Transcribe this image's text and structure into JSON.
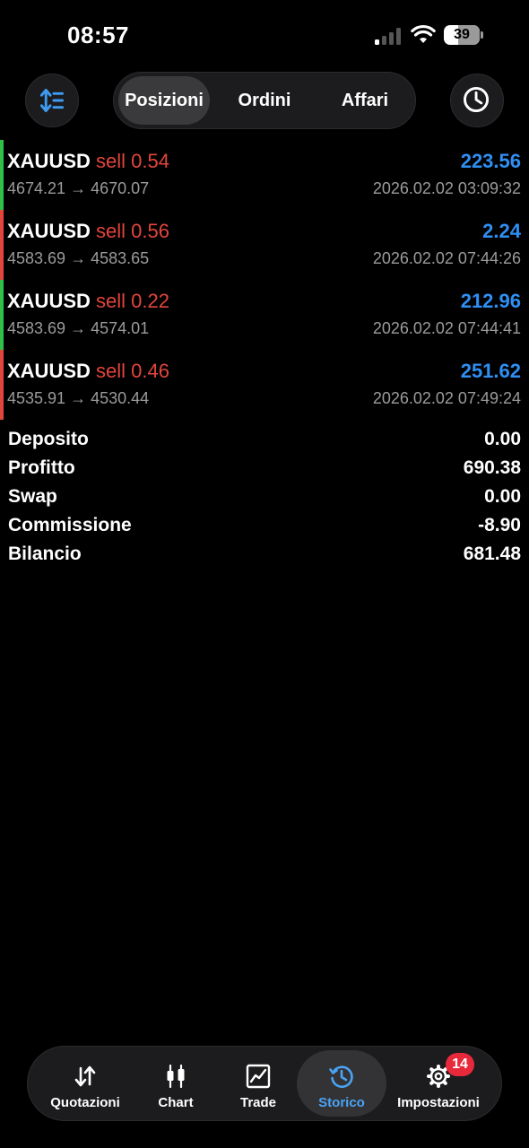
{
  "status_bar": {
    "time": "08:57",
    "battery": "39"
  },
  "toolbar": {
    "tabs": [
      {
        "label": "Posizioni",
        "active": true
      },
      {
        "label": "Ordini",
        "active": false
      },
      {
        "label": "Affari",
        "active": false
      }
    ],
    "left_icon": "sort-icon",
    "right_icon": "clock-icon"
  },
  "trades": [
    {
      "symbol": "XAUUSD",
      "direction": "sell 0.54",
      "profit": "223.56",
      "open_price": "4674.21",
      "arrow": "→",
      "close_price": "4670.07",
      "datetime": "2026.02.02 03:09:32",
      "bar_color": "#2ec14a"
    },
    {
      "symbol": "XAUUSD",
      "direction": "sell 0.56",
      "profit": "2.24",
      "open_price": "4583.69",
      "arrow": "→",
      "close_price": "4583.65",
      "datetime": "2026.02.02 07:44:26",
      "bar_color": "#e2453c"
    },
    {
      "symbol": "XAUUSD",
      "direction": "sell 0.22",
      "profit": "212.96",
      "open_price": "4583.69",
      "arrow": "→",
      "close_price": "4574.01",
      "datetime": "2026.02.02 07:44:41",
      "bar_color": "#2ec14a"
    },
    {
      "symbol": "XAUUSD",
      "direction": "sell 0.46",
      "profit": "251.62",
      "open_price": "4535.91",
      "arrow": "→",
      "close_price": "4530.44",
      "datetime": "2026.02.02 07:49:24",
      "bar_color": "#e2453c"
    }
  ],
  "summary": [
    {
      "label": "Deposito",
      "value": "0.00"
    },
    {
      "label": "Profitto",
      "value": "690.38"
    },
    {
      "label": "Swap",
      "value": "0.00"
    },
    {
      "label": "Commissione",
      "value": "-8.90"
    },
    {
      "label": "Bilancio",
      "value": "681.48"
    }
  ],
  "tabbar": {
    "items": [
      {
        "label": "Quotazioni",
        "icon": "quotes-icon"
      },
      {
        "label": "Chart",
        "icon": "candlestick-icon"
      },
      {
        "label": "Trade",
        "icon": "trade-chart-icon"
      },
      {
        "label": "Storico",
        "icon": "history-icon",
        "active": true
      },
      {
        "label": "Impostazioni",
        "icon": "gear-icon"
      }
    ],
    "settings_badge": "14"
  },
  "colors": {
    "accent": "#2f8ff3",
    "sell": "#e2453c",
    "buy_bar": "#2ec14a",
    "badge": "#e8293b"
  }
}
